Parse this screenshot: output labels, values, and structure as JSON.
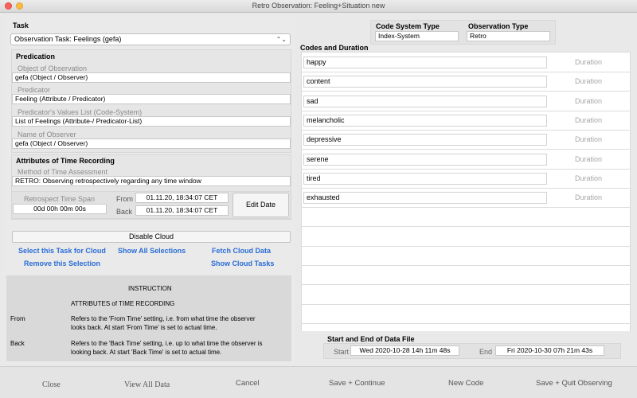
{
  "window": {
    "title": "Retro Observation: Feeling+Situation new"
  },
  "task": {
    "label": "Task",
    "selected": "Observation Task: Feelings (gefa)"
  },
  "predication": {
    "label": "Predication",
    "object_label": "Object of Observation",
    "object_value": "gefa (Object / Observer)",
    "predicator_label": "Predicator",
    "predicator_value": "Feeling (Attribute / Predicator)",
    "values_list_label": "Predicator's Values List (Code-System)",
    "values_list_value": "List of Feelings (Attribute-/ Predicator-List)",
    "observer_label": "Name of Observer",
    "observer_value": "gefa (Object / Observer)"
  },
  "time_recording": {
    "label": "Attributes of Time Recording",
    "method_label": "Method of Time Assessment",
    "method_value": "RETRO: Observing retrospectively regarding any time window",
    "span_label": "Retrospect Time Span",
    "span_value": "00d 00h 00m 00s",
    "from_label": "From",
    "from_value": "01.11.20, 18:34:07 CET",
    "back_label": "Back",
    "back_value": "01.11.20, 18:34:07 CET",
    "edit_date": "Edit Date"
  },
  "cloud": {
    "disable": "Disable Cloud",
    "select_task": "Select this Task for Cloud",
    "show_all": "Show All Selections",
    "fetch": "Fetch Cloud Data",
    "remove": "Remove this Selection",
    "show_tasks": "Show Cloud Tasks"
  },
  "instruction": {
    "title": "INSTRUCTION",
    "subtitle": "ATTRIBUTES of TIME RECORDING",
    "from_key": "From",
    "from_text_1": "Refers to the 'From Time' setting, i.e. from what time the observer",
    "from_text_2": "looks back. At start 'From Time' is set to actual time.",
    "back_key": "Back",
    "back_text_1": "Refers to the 'Back Time' setting, i.e. up to what time the observer is",
    "back_text_2": "looking back. At start 'Back Time' is set to actual time."
  },
  "codes": {
    "system_type_label": "Code System Type",
    "system_type_value": "Index-System",
    "observation_type_label": "Observation Type",
    "observation_type_value": "Retro",
    "section_label": "Codes and Duration",
    "duration_placeholder": "Duration",
    "items": [
      "happy",
      "content",
      "sad",
      "melancholic",
      "depressive",
      "serene",
      "tired",
      "exhausted"
    ]
  },
  "data_file": {
    "label": "Start and End of Data File",
    "start_label": "Start",
    "start_value": "Wed 2020-10-28  14h 11m 48s",
    "end_label": "End",
    "end_value": "Fri 2020-10-30  07h 21m 43s"
  },
  "footer": {
    "close": "Close",
    "view_all": "View All Data",
    "cancel": "Cancel",
    "save_continue": "Save + Continue",
    "new_code": "New Code",
    "save_quit": "Save + Quit Observing"
  }
}
